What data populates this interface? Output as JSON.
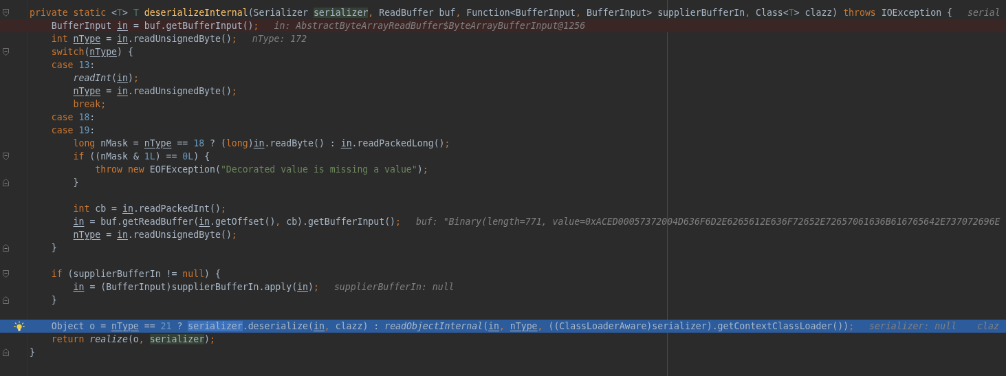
{
  "editor": {
    "lines": [
      {
        "kind": "normal",
        "gutter_mark": {
          "kind": "fold-start"
        },
        "tokens": [
          {
            "kind": "keyword",
            "text": "private static "
          },
          {
            "kind": "plain",
            "text": "<"
          },
          {
            "kind": "type-param",
            "text": "T"
          },
          {
            "kind": "plain",
            "text": "> "
          },
          {
            "kind": "type-param",
            "text": "T "
          },
          {
            "kind": "declaration",
            "text": "deserializeInternal"
          },
          {
            "kind": "plain",
            "text": "(Serializer "
          },
          {
            "kind": "usage",
            "text": "serializer"
          },
          {
            "kind": "punct",
            "text": ", "
          },
          {
            "kind": "plain",
            "text": "ReadBuffer buf"
          },
          {
            "kind": "punct",
            "text": ", "
          },
          {
            "kind": "plain",
            "text": "Function<BufferInput"
          },
          {
            "kind": "punct",
            "text": ", "
          },
          {
            "kind": "plain",
            "text": "BufferInput> supplierBufferIn"
          },
          {
            "kind": "punct",
            "text": ", "
          },
          {
            "kind": "plain",
            "text": "Class<"
          },
          {
            "kind": "type-param",
            "text": "T"
          },
          {
            "kind": "plain",
            "text": "> clazz) "
          },
          {
            "kind": "keyword",
            "text": "throws "
          },
          {
            "kind": "plain",
            "text": "IOException {"
          }
        ],
        "hints": [
          "serial"
        ]
      },
      {
        "kind": "breakpoint",
        "tokens": [
          {
            "kind": "plain",
            "text": "    BufferInput "
          },
          {
            "kind": "local-var",
            "text": "in"
          },
          {
            "kind": "plain",
            "text": " = buf.getBufferInput()"
          },
          {
            "kind": "punct",
            "text": ";"
          }
        ],
        "hints": [
          "in: AbstractByteArrayReadBuffer$ByteArrayBufferInput@1256"
        ]
      },
      {
        "kind": "normal",
        "tokens": [
          {
            "kind": "keyword",
            "text": "    int "
          },
          {
            "kind": "local-var",
            "text": "nType"
          },
          {
            "kind": "plain",
            "text": " = "
          },
          {
            "kind": "local-var",
            "text": "in"
          },
          {
            "kind": "plain",
            "text": ".readUnsignedByte()"
          },
          {
            "kind": "punct",
            "text": ";"
          }
        ],
        "hints": [
          "nType: 172"
        ]
      },
      {
        "kind": "normal",
        "gutter_mark": {
          "kind": "fold-start"
        },
        "tokens": [
          {
            "kind": "keyword",
            "text": "    switch"
          },
          {
            "kind": "plain",
            "text": "("
          },
          {
            "kind": "local-var",
            "text": "nType"
          },
          {
            "kind": "plain",
            "text": ") {"
          }
        ]
      },
      {
        "kind": "normal",
        "tokens": [
          {
            "kind": "keyword",
            "text": "    case "
          },
          {
            "kind": "number",
            "text": "13"
          },
          {
            "kind": "plain",
            "text": ":"
          }
        ]
      },
      {
        "kind": "normal",
        "tokens": [
          {
            "kind": "static-call",
            "text": "        readInt"
          },
          {
            "kind": "plain",
            "text": "("
          },
          {
            "kind": "local-var",
            "text": "in"
          },
          {
            "kind": "plain",
            "text": ")"
          },
          {
            "kind": "punct",
            "text": ";"
          }
        ]
      },
      {
        "kind": "normal",
        "tokens": [
          {
            "kind": "local-var",
            "text": "        nType"
          },
          {
            "kind": "plain",
            "text": " = "
          },
          {
            "kind": "local-var",
            "text": "in"
          },
          {
            "kind": "plain",
            "text": ".readUnsignedByte()"
          },
          {
            "kind": "punct",
            "text": ";"
          }
        ]
      },
      {
        "kind": "normal",
        "tokens": [
          {
            "kind": "keyword",
            "text": "        break;"
          }
        ]
      },
      {
        "kind": "normal",
        "tokens": [
          {
            "kind": "keyword",
            "text": "    case "
          },
          {
            "kind": "number",
            "text": "18"
          },
          {
            "kind": "plain",
            "text": ":"
          }
        ]
      },
      {
        "kind": "normal",
        "tokens": [
          {
            "kind": "keyword",
            "text": "    case "
          },
          {
            "kind": "number",
            "text": "19"
          },
          {
            "kind": "plain",
            "text": ":"
          }
        ]
      },
      {
        "kind": "normal",
        "tokens": [
          {
            "kind": "keyword",
            "text": "        long "
          },
          {
            "kind": "plain",
            "text": "nMask = "
          },
          {
            "kind": "local-var",
            "text": "nType"
          },
          {
            "kind": "plain",
            "text": " == "
          },
          {
            "kind": "number",
            "text": "18"
          },
          {
            "kind": "plain",
            "text": " ? ("
          },
          {
            "kind": "keyword",
            "text": "long"
          },
          {
            "kind": "plain",
            "text": ")"
          },
          {
            "kind": "local-var",
            "text": "in"
          },
          {
            "kind": "plain",
            "text": ".readByte() : "
          },
          {
            "kind": "local-var",
            "text": "in"
          },
          {
            "kind": "plain",
            "text": ".readPackedLong()"
          },
          {
            "kind": "punct",
            "text": ";"
          }
        ]
      },
      {
        "kind": "normal",
        "gutter_mark": {
          "kind": "fold-start"
        },
        "tokens": [
          {
            "kind": "keyword",
            "text": "        if "
          },
          {
            "kind": "plain",
            "text": "((nMask & "
          },
          {
            "kind": "number",
            "text": "1L"
          },
          {
            "kind": "plain",
            "text": ") == "
          },
          {
            "kind": "number",
            "text": "0L"
          },
          {
            "kind": "plain",
            "text": ") {"
          }
        ]
      },
      {
        "kind": "normal",
        "tokens": [
          {
            "kind": "keyword",
            "text": "            throw new "
          },
          {
            "kind": "plain",
            "text": "EOFException("
          },
          {
            "kind": "string",
            "text": "\"Decorated value is missing a value\""
          },
          {
            "kind": "plain",
            "text": ")"
          },
          {
            "kind": "punct",
            "text": ";"
          }
        ]
      },
      {
        "kind": "normal",
        "gutter_mark": {
          "kind": "fold-end"
        },
        "tokens": [
          {
            "kind": "plain",
            "text": "        }"
          }
        ]
      },
      {
        "kind": "normal"
      },
      {
        "kind": "normal",
        "tokens": [
          {
            "kind": "keyword",
            "text": "        int "
          },
          {
            "kind": "plain",
            "text": "cb = "
          },
          {
            "kind": "local-var",
            "text": "in"
          },
          {
            "kind": "plain",
            "text": ".readPackedInt()"
          },
          {
            "kind": "punct",
            "text": ";"
          }
        ]
      },
      {
        "kind": "normal",
        "tokens": [
          {
            "kind": "local-var",
            "text": "        in"
          },
          {
            "kind": "plain",
            "text": " = buf.getReadBuffer("
          },
          {
            "kind": "local-var",
            "text": "in"
          },
          {
            "kind": "plain",
            "text": ".getOffset()"
          },
          {
            "kind": "punct",
            "text": ", "
          },
          {
            "kind": "plain",
            "text": "cb).getBufferInput()"
          },
          {
            "kind": "punct",
            "text": ";"
          }
        ],
        "hints": [
          "buf: \"Binary(length=771, value=0xACED00057372004D636F6D2E6265612E636F72652E72657061636B616765642E737072696E"
        ]
      },
      {
        "kind": "normal",
        "tokens": [
          {
            "kind": "local-var",
            "text": "        nType"
          },
          {
            "kind": "plain",
            "text": " = "
          },
          {
            "kind": "local-var",
            "text": "in"
          },
          {
            "kind": "plain",
            "text": ".readUnsignedByte()"
          },
          {
            "kind": "punct",
            "text": ";"
          }
        ]
      },
      {
        "kind": "normal",
        "gutter_mark": {
          "kind": "fold-end"
        },
        "tokens": [
          {
            "kind": "plain",
            "text": "    }"
          }
        ]
      },
      {
        "kind": "normal"
      },
      {
        "kind": "normal",
        "gutter_mark": {
          "kind": "fold-start"
        },
        "tokens": [
          {
            "kind": "keyword",
            "text": "    if "
          },
          {
            "kind": "plain",
            "text": "(supplierBufferIn != "
          },
          {
            "kind": "keyword",
            "text": "null"
          },
          {
            "kind": "plain",
            "text": ") {"
          }
        ]
      },
      {
        "kind": "normal",
        "tokens": [
          {
            "kind": "local-var",
            "text": "        in"
          },
          {
            "kind": "plain",
            "text": " = (BufferInput)supplierBufferIn.apply("
          },
          {
            "kind": "local-var",
            "text": "in"
          },
          {
            "kind": "plain",
            "text": ")"
          },
          {
            "kind": "punct",
            "text": ";"
          }
        ],
        "hints": [
          "supplierBufferIn: null"
        ]
      },
      {
        "kind": "normal",
        "gutter_mark": {
          "kind": "fold-end"
        },
        "tokens": [
          {
            "kind": "plain",
            "text": "    }"
          }
        ]
      },
      {
        "kind": "normal"
      },
      {
        "kind": "execution",
        "gutter_mark": {
          "kind": "bulb"
        },
        "tokens": [
          {
            "kind": "plain",
            "text": "    Object o = "
          },
          {
            "kind": "local-var",
            "text": "nType"
          },
          {
            "kind": "plain",
            "text": " == "
          },
          {
            "kind": "number",
            "text": "21"
          },
          {
            "kind": "plain",
            "text": " ? "
          },
          {
            "kind": "usage",
            "text": "serializer"
          },
          {
            "kind": "plain",
            "text": ".deserialize("
          },
          {
            "kind": "local-var",
            "text": "in"
          },
          {
            "kind": "punct",
            "text": ", "
          },
          {
            "kind": "plain",
            "text": "clazz) : "
          },
          {
            "kind": "static-call",
            "text": "readObjectInternal"
          },
          {
            "kind": "plain",
            "text": "("
          },
          {
            "kind": "local-var",
            "text": "in"
          },
          {
            "kind": "punct",
            "text": ", "
          },
          {
            "kind": "local-var",
            "text": "nType"
          },
          {
            "kind": "punct",
            "text": ", "
          },
          {
            "kind": "plain",
            "text": "((ClassLoaderAware)serializer).getContextClassLoader())"
          },
          {
            "kind": "punct",
            "text": ";"
          }
        ],
        "hints": [
          "serializer: null",
          "claz"
        ]
      },
      {
        "kind": "normal",
        "tokens": [
          {
            "kind": "keyword",
            "text": "    return "
          },
          {
            "kind": "static-call",
            "text": "realize"
          },
          {
            "kind": "plain",
            "text": "(o"
          },
          {
            "kind": "punct",
            "text": ", "
          },
          {
            "kind": "usage",
            "text": "serializer"
          },
          {
            "kind": "plain",
            "text": ")"
          },
          {
            "kind": "punct",
            "text": ";"
          }
        ]
      },
      {
        "kind": "normal",
        "gutter_mark": {
          "kind": "fold-end"
        },
        "tokens": [
          {
            "kind": "plain",
            "text": "}"
          }
        ]
      },
      {
        "kind": "normal"
      }
    ]
  }
}
